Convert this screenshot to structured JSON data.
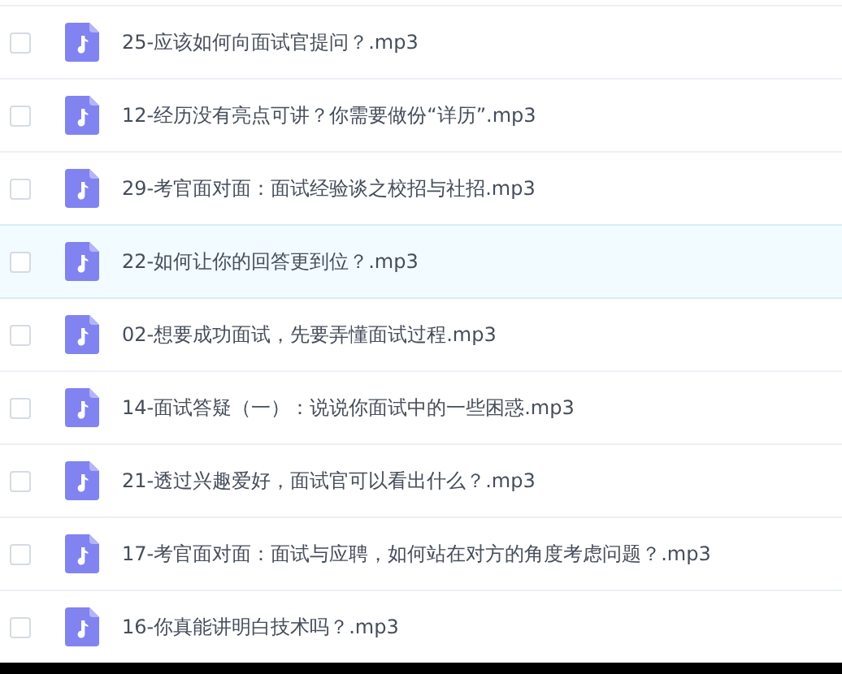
{
  "files": [
    {
      "name": "25-应该如何向面试官提问？.mp3",
      "checked": false,
      "highlighted": false,
      "kind": "audio"
    },
    {
      "name": "12-经历没有亮点可讲？你需要做份“详历”.mp3",
      "checked": false,
      "highlighted": false,
      "kind": "audio"
    },
    {
      "name": "29-考官面对面：面试经验谈之校招与社招.mp3",
      "checked": false,
      "highlighted": false,
      "kind": "audio"
    },
    {
      "name": "22-如何让你的回答更到位？.mp3",
      "checked": false,
      "highlighted": true,
      "kind": "audio"
    },
    {
      "name": "02-想要成功面试，先要弄懂面试过程.mp3",
      "checked": false,
      "highlighted": false,
      "kind": "audio"
    },
    {
      "name": "14-面试答疑（一）：说说你面试中的一些困惑.mp3",
      "checked": false,
      "highlighted": false,
      "kind": "audio"
    },
    {
      "name": "21-透过兴趣爱好，面试官可以看出什么？.mp3",
      "checked": false,
      "highlighted": false,
      "kind": "audio"
    },
    {
      "name": "17-考官面对面：面试与应聘，如何站在对方的角度考虑问题？.mp3",
      "checked": false,
      "highlighted": false,
      "kind": "audio"
    },
    {
      "name": "16-你真能讲明白技术吗？.mp3",
      "checked": false,
      "highlighted": false,
      "kind": "audio"
    }
  ]
}
